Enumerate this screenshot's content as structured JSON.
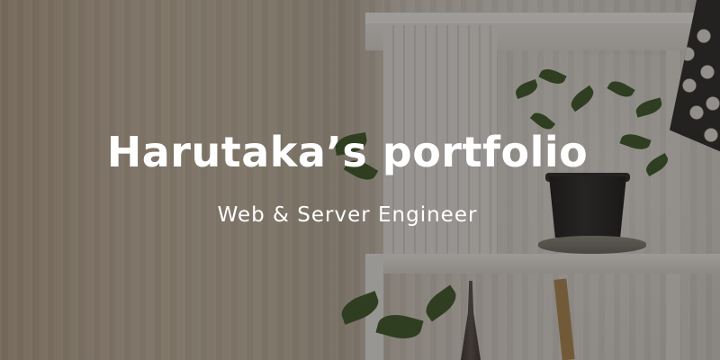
{
  "hero": {
    "title": "Harutaka’s portfolio",
    "subtitle": "Web & Server Engineer"
  },
  "colors": {
    "text": "#ffffff",
    "overlay": "#1c1814",
    "shelf": "#f2f1ef",
    "plant": "#3d5a2a",
    "pot": "#1b1b1b"
  }
}
